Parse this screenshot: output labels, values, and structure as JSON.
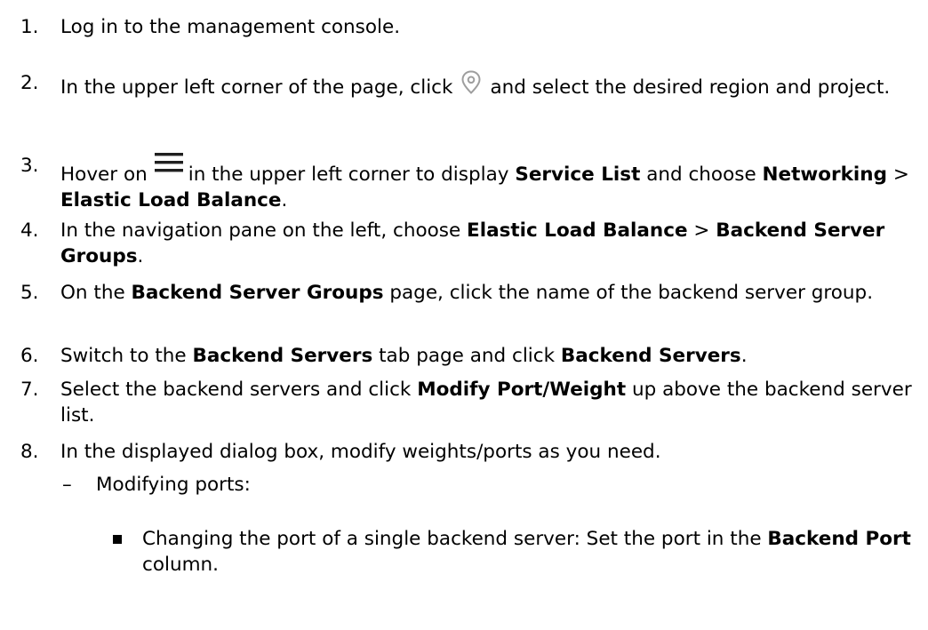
{
  "steps": [
    {
      "num": "1.",
      "text": "Log in to the management console."
    },
    {
      "num": "2.",
      "part1": "In the upper left corner of the page, click",
      "icon": "location-pin-icon",
      "part2": "and select the desired region and project."
    },
    {
      "num": "3.",
      "part1": "Hover on",
      "icon": "menu-icon",
      "part2": "in the upper left corner to display",
      "b1": "Service List",
      "part3": "and choose",
      "b2": "Networking",
      "sep": ">",
      "b3": "Elastic Load Balance",
      "end": "."
    },
    {
      "num": "4.",
      "part1": "In the navigation pane on the left, choose",
      "b1": "Elastic Load Balance",
      "sep": ">",
      "b2": "Backend Server Groups",
      "end": "."
    },
    {
      "num": "5.",
      "part1": "On the",
      "b1": "Backend Server Groups",
      "part2": "page, click the name of the backend server group."
    },
    {
      "num": "6.",
      "part1": "Switch to the",
      "b1": "Backend Servers",
      "part2": "tab page and click",
      "b2": "Backend Servers",
      "end": "."
    },
    {
      "num": "7.",
      "part1": "Select the backend servers and click",
      "b1": "Modify Port/Weight",
      "part2": "up above the backend server list."
    },
    {
      "num": "8.",
      "text": "In the displayed dialog box, modify weights/ports as you need."
    }
  ],
  "sub": {
    "bullet": "–",
    "text": "Modifying ports:"
  },
  "subsub": {
    "part1": "Changing the port of a single backend server: Set the port in the",
    "b1": "Backend Port",
    "part2": "column."
  },
  "colors": {
    "text": "#000000",
    "icon_gray": "#9e9e9e",
    "icon_dark": "#1f1f1f"
  }
}
